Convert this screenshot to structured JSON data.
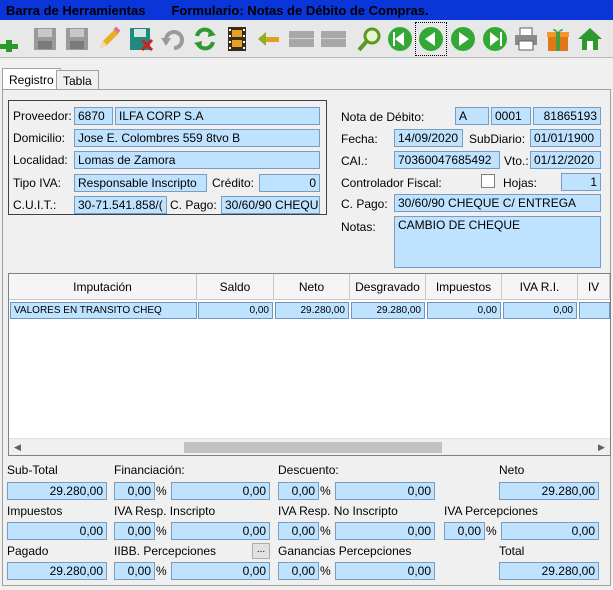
{
  "window": {
    "title": "Barra de Herramientas",
    "form_title": "Formulario: Notas de Débito de Compras."
  },
  "toolbar": [
    {
      "name": "add-button",
      "icon": "plus-icon"
    },
    {
      "name": "save-button",
      "icon": "floppy-icon"
    },
    {
      "name": "save-copy-button",
      "icon": "floppy-icon"
    },
    {
      "name": "edit-button",
      "icon": "pencil-icon"
    },
    {
      "name": "delete-button",
      "icon": "floppy-delete-icon"
    },
    {
      "name": "undo-button",
      "icon": "undo-icon"
    },
    {
      "name": "refresh-button",
      "icon": "refresh-icon"
    },
    {
      "name": "film-button",
      "icon": "film-icon"
    },
    {
      "name": "back-button",
      "icon": "arrow-left-icon"
    },
    {
      "name": "blank1-button",
      "icon": "blank-icon"
    },
    {
      "name": "blank2-button",
      "icon": "blank-icon"
    },
    {
      "name": "search-button",
      "icon": "search-icon"
    },
    {
      "name": "first-button",
      "icon": "first-icon"
    },
    {
      "name": "prev-button",
      "icon": "prev-icon"
    },
    {
      "name": "next-button",
      "icon": "next-icon"
    },
    {
      "name": "last-button",
      "icon": "last-icon"
    },
    {
      "name": "print-button",
      "icon": "printer-icon"
    },
    {
      "name": "gift-button",
      "icon": "gift-icon"
    },
    {
      "name": "home-button",
      "icon": "home-icon"
    }
  ],
  "tabs": {
    "registro": "Registro",
    "tabla": "Tabla"
  },
  "proveedor": {
    "label": "Proveedor:",
    "code": "6870",
    "name": "ILFA CORP S.A",
    "domicilio_label": "Domicilio:",
    "domicilio": "Jose E. Colombres 559 8tvo B",
    "localidad_label": "Localidad:",
    "localidad": "Lomas de Zamora",
    "tipo_iva_label": "Tipo IVA:",
    "tipo_iva": "Responsable Inscripto",
    "credito_label": "Crédito:",
    "credito": "0",
    "cuit_label": "C.U.I.T.:",
    "cuit": "30-71.541.858/(",
    "cpago_label": "C. Pago:",
    "cpago": "30/60/90 CHEQU"
  },
  "nota": {
    "label": "Nota de Débito:",
    "letra": "A",
    "punto": "0001",
    "numero": "81865193",
    "fecha_label": "Fecha:",
    "fecha": "14/09/2020",
    "subdiario_label": "SubDiario:",
    "subdiario": "01/01/1900",
    "cai_label": "CAI.:",
    "cai": "70360047685492",
    "vto_label": "Vto.:",
    "vto": "01/12/2020",
    "controlador_label": "Controlador Fiscal:",
    "hojas_label": "Hojas:",
    "hojas": "1",
    "cpago_label": "C. Pago:",
    "cpago": "30/60/90 CHEQUE C/ ENTREGA",
    "notas_label": "Notas:",
    "notas": "CAMBIO DE CHEQUE"
  },
  "grid": {
    "headers": [
      "Imputación",
      "Saldo",
      "Neto",
      "Desgravado",
      "Impuestos",
      "IVA R.I.",
      "IV"
    ],
    "rows": [
      [
        "VALORES EN TRANSITO CHEQ",
        "0,00",
        "29.280,00",
        "29.280,00",
        "0,00",
        "0,00",
        ""
      ]
    ]
  },
  "totals": {
    "subtotal_label": "Sub-Total",
    "subtotal": "29.280,00",
    "financiacion_label": "Financiación:",
    "financiacion_pct": "0,00",
    "financiacion": "0,00",
    "descuento_label": "Descuento:",
    "descuento_pct": "0,00",
    "descuento": "0,00",
    "neto_label": "Neto",
    "neto": "29.280,00",
    "impuestos_label": "Impuestos",
    "impuestos": "0,00",
    "iva_ri_label": "IVA Resp. Inscripto",
    "iva_ri_pct": "0,00",
    "iva_ri": "0,00",
    "iva_rni_label": "IVA Resp. No Inscripto",
    "iva_rni_pct": "0,00",
    "iva_rni": "0,00",
    "iva_perc_label": "IVA Percepciones",
    "iva_perc_pct": "0,00",
    "iva_perc": "0,00",
    "pagado_label": "Pagado",
    "pagado": "29.280,00",
    "iibb_label": "IIBB. Percepciones",
    "iibb_btn": "...",
    "iibb_pct": "0,00",
    "iibb": "0,00",
    "ganancias_label": "Ganancias Percepciones",
    "ganancias_pct": "0,00",
    "ganancias": "0,00",
    "total_label": "Total",
    "total": "29.280,00",
    "pct_sign": "%"
  }
}
